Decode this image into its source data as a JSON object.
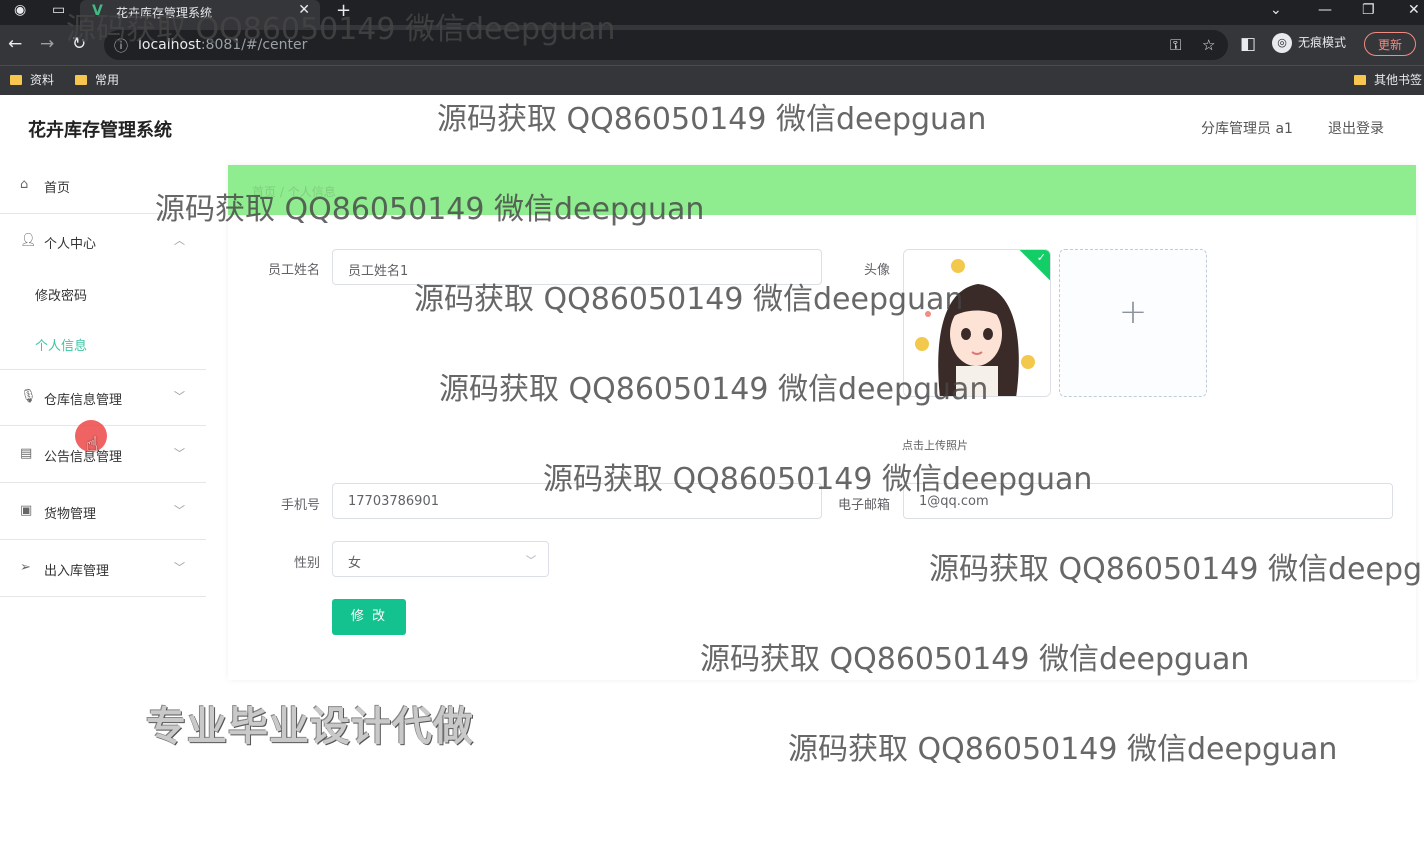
{
  "browser": {
    "tab_title": "花卉库存管理系统",
    "url_host": "localhost",
    "url_rest": ":8081/#/center",
    "incognito_label": "无痕模式",
    "update_label": "更新",
    "bookmarks": [
      "资料",
      "常用"
    ],
    "other_bookmarks": "其他书签"
  },
  "header": {
    "title": "花卉库存管理系统",
    "user": "分库管理员 a1",
    "logout": "退出登录"
  },
  "sidebar": {
    "home": "首页",
    "personal_center": "个人中心",
    "change_password": "修改密码",
    "personal_info": "个人信息",
    "warehouse": "仓库信息管理",
    "notice": "公告信息管理",
    "goods": "货物管理",
    "inout": "出入库管理"
  },
  "breadcrumb": [
    "首页",
    "个人信息"
  ],
  "form": {
    "name_label": "员工姓名",
    "name_value": "员工姓名1",
    "avatar_label": "头像",
    "upload_tip": "点击上传照片",
    "phone_label": "手机号",
    "phone_value": "17703786901",
    "email_label": "电子邮箱",
    "email_value": "1@qq.com",
    "gender_label": "性别",
    "gender_value": "女",
    "submit": "修 改"
  },
  "watermark": "源码获取 QQ86050149 微信deepguan",
  "promo": "专业毕业设计代做",
  "colors": {
    "accent": "#13c28f",
    "active_menu": "#3cc5a3",
    "breadcrumb_bar": "#8fec8f"
  }
}
